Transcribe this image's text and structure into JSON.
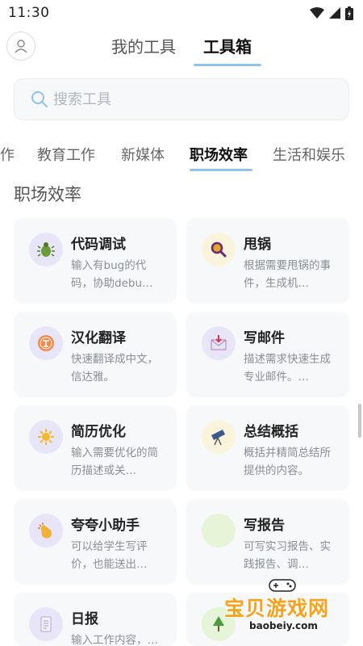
{
  "status": {
    "time": "11:30"
  },
  "header": {
    "tabs": [
      {
        "label": "我的工具",
        "active": false
      },
      {
        "label": "工具箱",
        "active": true
      }
    ]
  },
  "search": {
    "placeholder": "搜索工具"
  },
  "categories": [
    {
      "label": "作",
      "active": false
    },
    {
      "label": "教育工作",
      "active": false
    },
    {
      "label": "新媒体",
      "active": false
    },
    {
      "label": "职场效率",
      "active": true
    },
    {
      "label": "生活和娱乐",
      "active": false
    }
  ],
  "section": {
    "title": "职场效率"
  },
  "cards": [
    {
      "title": "代码调试",
      "desc": "输入有bug的代码，协助debu…",
      "icon": "bug-icon",
      "icon_bg": "#e7e5f7"
    },
    {
      "title": "甩锅",
      "desc": "根据需要甩锅的事件，生成机…",
      "icon": "magnifier-icon",
      "icon_bg": "#fbf4dc"
    },
    {
      "title": "汉化翻译",
      "desc": "快速翻译成中文，信达雅。",
      "icon": "translate-icon",
      "icon_bg": "#e7e5f7"
    },
    {
      "title": "写邮件",
      "desc": "描述需求快速生成专业邮件。…",
      "icon": "mail-icon",
      "icon_bg": "#e7e5f7"
    },
    {
      "title": "简历优化",
      "desc": "输入需要优化的简历描述或关…",
      "icon": "sparkle-icon",
      "icon_bg": "#e7e5f7"
    },
    {
      "title": "总结概括",
      "desc": "概括并精简总结所提供的内容。",
      "icon": "telescope-icon",
      "icon_bg": "#fbf4dc"
    },
    {
      "title": "夸夸小助手",
      "desc": "可以给学生写评价，也能送出…",
      "icon": "clap-icon",
      "icon_bg": "#e7e5f7"
    },
    {
      "title": "写报告",
      "desc": "可写实习报告、实践报告、调…",
      "icon": "report-icon",
      "icon_bg": "#e6f5d8"
    },
    {
      "title": "日报",
      "desc": "输入工作内容，…",
      "icon": "notepad-icon",
      "icon_bg": "#e7e5f7"
    },
    {
      "title": "",
      "desc": "",
      "icon": "tree-icon",
      "icon_bg": "#e6f5d8"
    }
  ],
  "watermark": {
    "text": "宝贝游戏网",
    "url": "baobeiy.com"
  }
}
